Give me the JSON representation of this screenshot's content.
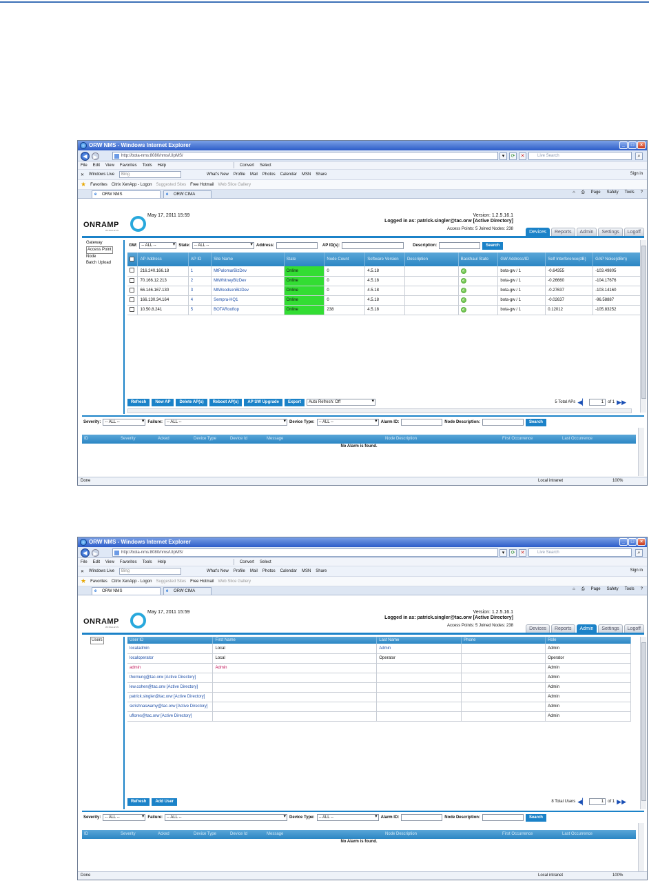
{
  "colors": {
    "accent": "#1b82c8",
    "online": "#33dd33",
    "ie_title": "#2c5cc8"
  },
  "browser": {
    "window_title": "ORW NMS - Windows Internet Explorer",
    "address": "http://bota-nms:8080/nms/UIpMS/",
    "live_search_placeholder": "Live Search",
    "menu": [
      "File",
      "Edit",
      "View",
      "Favorites",
      "Tools",
      "Help"
    ],
    "convert": "Convert",
    "select": "Select",
    "live_bar": {
      "label": "Windows Live",
      "bing": "Bing",
      "links": [
        "What's New",
        "Profile",
        "Mail",
        "Photos",
        "Calendar",
        "MSN",
        "Share"
      ],
      "signin": "Sign in"
    },
    "favorites": {
      "label": "Favorites",
      "items": [
        "Citrix XenApp - Logon",
        "Suggested Sites",
        "Free Hotmail",
        "Web Slice Gallery"
      ]
    },
    "tabs": [
      "ORW NMS",
      "ORW CIMA"
    ],
    "commands": [
      "Page",
      "Safety",
      "Tools"
    ],
    "status": {
      "done": "Done",
      "zone": "Local intranet",
      "zoom": "100%"
    }
  },
  "header": {
    "logo": "ONRAMP",
    "logo_sub": "WIRELESS",
    "datetime": "May 17, 2011 15:59",
    "version": "Version: 1.2.5.16.1",
    "logged_in": "Logged in as: patrick.singler@tac.orw [Active Directory]",
    "stats": "Access Points: 5 Joined Nodes: 238",
    "tabs": [
      "Devices",
      "Reports",
      "Admin",
      "Settings",
      "Logoff"
    ]
  },
  "devices_view": {
    "sidebar": [
      "Gateway",
      "Access Point",
      "Node",
      "Batch Upload"
    ],
    "filters": {
      "gw_label": "GW:",
      "all": "-- ALL --",
      "state_label": "State:",
      "address_label": "Address:",
      "apids_label": "AP ID(s):",
      "description_label": "Description:",
      "search": "Search"
    },
    "columns": [
      "AP Address",
      "AP ID",
      "Site Name",
      "State",
      "Node Count",
      "Software Version",
      "Description",
      "Backhaul State",
      "GW Address/ID",
      "Self Interference(dB)",
      "GAP Noise(dBm)"
    ],
    "rows": [
      {
        "address": "216.240.166.18",
        "id": "1",
        "site": "MtPalomarBizDev",
        "state": "Online",
        "nodes": "0",
        "software": "4.5.18",
        "desc": "",
        "gw": "bota-gw / 1",
        "self": "-0.64355",
        "noise": "-103.49805"
      },
      {
        "address": "70.166.12.213",
        "id": "2",
        "site": "MtWhitneyBizDev",
        "state": "Online",
        "nodes": "0",
        "software": "4.5.18",
        "desc": "",
        "gw": "bota-gw / 1",
        "self": "-0.26660",
        "noise": "-104.17676"
      },
      {
        "address": "66.146.167.130",
        "id": "3",
        "site": "MtWoodsonBizDev",
        "state": "Online",
        "nodes": "0",
        "software": "4.5.18",
        "desc": "",
        "gw": "bota-gw / 1",
        "self": "-0.27637",
        "noise": "-103.14160"
      },
      {
        "address": "166.130.34.164",
        "id": "4",
        "site": "Sempra-HQ1",
        "state": "Online",
        "nodes": "0",
        "software": "4.5.18",
        "desc": "",
        "gw": "bota-gw / 1",
        "self": "-0.02637",
        "noise": "-96.58887"
      },
      {
        "address": "10.50.8.241",
        "id": "5",
        "site": "BOTARooftop",
        "state": "Online",
        "nodes": "238",
        "software": "4.5.18",
        "desc": "",
        "gw": "bota-gw / 1",
        "self": "0.12012",
        "noise": "-105.83252"
      }
    ],
    "toolbar": [
      "Refresh",
      "New AP",
      "Delete AP(s)",
      "Reboot AP(s)",
      "AP SW Upgrade",
      "Export"
    ],
    "auto_refresh": "Auto Refresh: Off",
    "total": "5 Total APs",
    "page": "1",
    "of": "of 1"
  },
  "admin_view": {
    "sidebar": [
      "Users"
    ],
    "columns": [
      "User ID",
      "First Name",
      "Last Name",
      "Phone",
      "Role"
    ],
    "rows": [
      {
        "user": "localadmin",
        "first": "Local",
        "last": "Admin",
        "phone": "",
        "role": "Admin"
      },
      {
        "user": "localoperator",
        "first": "Local",
        "last": "Operator",
        "phone": "",
        "role": "Operator"
      },
      {
        "user": "admin",
        "first": "Admin",
        "last": "",
        "phone": "",
        "role": "Admin"
      },
      {
        "user": "thornung@tac.orw [Active Directory]",
        "first": "",
        "last": "",
        "phone": "",
        "role": "Admin"
      },
      {
        "user": "lew.cohen@tac.orw [Active Directory]",
        "first": "",
        "last": "",
        "phone": "",
        "role": "Admin"
      },
      {
        "user": "patrick.singler@tac.orw [Active Directory]",
        "first": "",
        "last": "",
        "phone": "",
        "role": "Admin"
      },
      {
        "user": "skrishnaswamy@tac.orw [Active Directory]",
        "first": "",
        "last": "",
        "phone": "",
        "role": "Admin"
      },
      {
        "user": "uflores@tac.orw [Active Directory]",
        "first": "",
        "last": "",
        "phone": "",
        "role": "Admin"
      }
    ],
    "toolbar": [
      "Refresh",
      "Add User"
    ],
    "total": "8 Total Users",
    "page": "1",
    "of": "of 1"
  },
  "alarms": {
    "severity_label": "Severity:",
    "failure_label": "Failure:",
    "device_type_label": "Device Type:",
    "alarm_id_label": "Alarm ID:",
    "node_desc_label": "Node Description:",
    "all": "-- ALL --",
    "search": "Search",
    "columns": [
      "ID",
      "Severity",
      "Acked",
      "Device Type",
      "Device Id",
      "Message",
      "Node Description",
      "First Occurrence",
      "Last Occurrence"
    ],
    "empty": "No Alarm is found."
  }
}
